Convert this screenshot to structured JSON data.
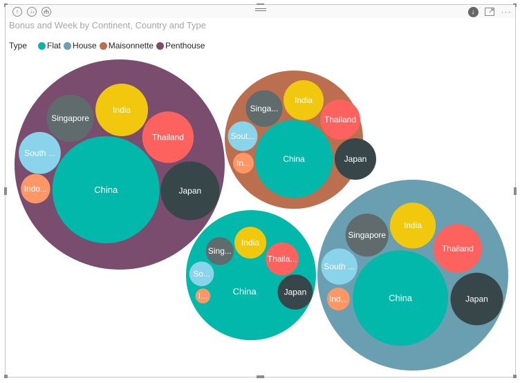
{
  "header": {
    "icons": [
      "drill-up-icon",
      "expand-all-down-icon",
      "drill-hierarchy-icon",
      "drag-grip-icon",
      "focus-download-icon",
      "focus-mode-icon",
      "more-options-icon"
    ]
  },
  "colors": {
    "Flat": "#01b8aa",
    "House": "#6a9fb1",
    "Maisonnette": "#bc6f4e",
    "Penthouse": "#7a4d6f",
    "China": "#01b8aa",
    "India": "#f2c80f",
    "Thailand": "#fd625e",
    "Japan": "#374649",
    "Singapore": "#5f6b6d",
    "South Korea": "#8ad4eb",
    "Indonesia": "#fe9666"
  },
  "chart_data": {
    "type": "packed-bubble",
    "title": "Bonus and Week by Continent, Country and Type",
    "legend": {
      "title": "Type",
      "position": "top-left",
      "entries": [
        "Flat",
        "House",
        "Maisonnette",
        "Penthouse"
      ]
    },
    "groups": [
      {
        "type": "Penthouse",
        "relative_size": 1.0,
        "countries": [
          {
            "name": "China",
            "label": "China",
            "relative_size": 1.0
          },
          {
            "name": "Japan",
            "label": "Japan",
            "relative_size": 0.55
          },
          {
            "name": "Thailand",
            "label": "Thailand",
            "relative_size": 0.48
          },
          {
            "name": "India",
            "label": "India",
            "relative_size": 0.49
          },
          {
            "name": "Singapore",
            "label": "Singapore",
            "relative_size": 0.44
          },
          {
            "name": "South Korea",
            "label": "South ...",
            "relative_size": 0.39
          },
          {
            "name": "Indonesia",
            "label": "Indo...",
            "relative_size": 0.27
          }
        ]
      },
      {
        "type": "Maisonnette",
        "relative_size": 0.66,
        "countries": [
          {
            "name": "China",
            "label": "China",
            "relative_size": 1.0
          },
          {
            "name": "Japan",
            "label": "Japan",
            "relative_size": 0.53
          },
          {
            "name": "Thailand",
            "label": "Thailand",
            "relative_size": 0.51
          },
          {
            "name": "India",
            "label": "India",
            "relative_size": 0.51
          },
          {
            "name": "Singapore",
            "label": "Singa...",
            "relative_size": 0.47
          },
          {
            "name": "South Korea",
            "label": "Sout...",
            "relative_size": 0.38
          },
          {
            "name": "Indonesia",
            "label": "In...",
            "relative_size": 0.26
          }
        ]
      },
      {
        "type": "Flat",
        "relative_size": 0.62,
        "countries": [
          {
            "name": "China",
            "label": "China",
            "relative_size": 1.0
          },
          {
            "name": "Japan",
            "label": "Japan",
            "relative_size": 0.52
          },
          {
            "name": "Thailand",
            "label": "Thaila...",
            "relative_size": 0.42
          },
          {
            "name": "India",
            "label": "India",
            "relative_size": 0.4
          },
          {
            "name": "Singapore",
            "label": "Sing...",
            "relative_size": 0.35
          },
          {
            "name": "South Korea",
            "label": "So...",
            "relative_size": 0.31
          },
          {
            "name": "Indonesia",
            "label": "I...",
            "relative_size": 0.19
          }
        ]
      },
      {
        "type": "House",
        "relative_size": 0.91,
        "countries": [
          {
            "name": "China",
            "label": "China",
            "relative_size": 1.0
          },
          {
            "name": "Japan",
            "label": "Japan",
            "relative_size": 0.55
          },
          {
            "name": "Thailand",
            "label": "Thailand",
            "relative_size": 0.51
          },
          {
            "name": "India",
            "label": "India",
            "relative_size": 0.48
          },
          {
            "name": "Singapore",
            "label": "Singapore",
            "relative_size": 0.45
          },
          {
            "name": "South Korea",
            "label": "South ...",
            "relative_size": 0.38
          },
          {
            "name": "Indonesia",
            "label": "Ind...",
            "relative_size": 0.24
          }
        ]
      }
    ]
  }
}
